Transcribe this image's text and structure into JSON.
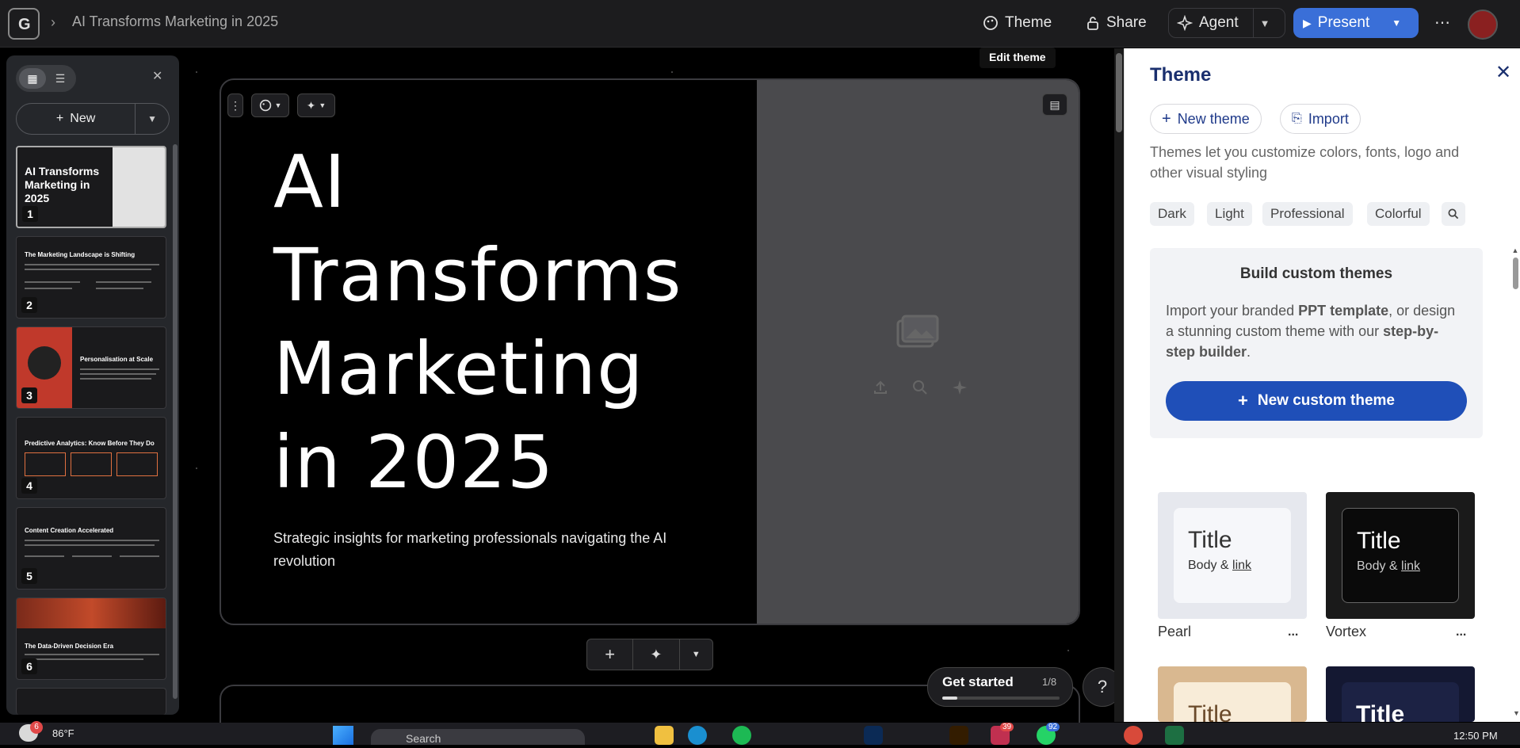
{
  "topbar": {
    "doc_title": "AI Transforms Marketing in 2025",
    "theme_label": "Theme",
    "share_label": "Share",
    "agent_label": "Agent",
    "present_label": "Present",
    "tooltip": "Edit theme"
  },
  "sidebar": {
    "new_label": "New",
    "slides": [
      {
        "num": "1",
        "title": "AI Transforms Marketing in 2025"
      },
      {
        "num": "2",
        "title": "The Marketing Landscape is Shifting"
      },
      {
        "num": "3",
        "title": "Personalisation at Scale"
      },
      {
        "num": "4",
        "title": "Predictive Analytics: Know Before They Do"
      },
      {
        "num": "5",
        "title": "Content Creation Accelerated"
      },
      {
        "num": "6",
        "title": "The Data-Driven Decision Era"
      }
    ]
  },
  "slide": {
    "title": "AI Transforms Marketing in 2025",
    "subtitle": "Strategic insights for marketing professionals navigating the AI revolution"
  },
  "get_started": {
    "label": "Get started",
    "progress": "1/8",
    "progress_fraction": 0.125
  },
  "help_label": "?",
  "panel": {
    "heading": "Theme",
    "new_theme_label": "New theme",
    "import_label": "Import",
    "description": "Themes let you customize colors, fonts, logo and other visual styling",
    "filters": [
      "Dark",
      "Light",
      "Professional",
      "Colorful"
    ],
    "custom": {
      "heading": "Build custom themes",
      "text_a": "Import your branded ",
      "text_b": "PPT template",
      "text_c": ", or design a stunning custom theme with our ",
      "text_d": "step-by-step builder",
      "text_e": ".",
      "button": "New custom theme"
    },
    "themes": [
      {
        "name": "Pearl",
        "title": "Title",
        "body": "Body & ",
        "link": "link",
        "more": "..."
      },
      {
        "name": "Vortex",
        "title": "Title",
        "body": "Body & ",
        "link": "link",
        "more": "..."
      },
      {
        "title": "Title"
      },
      {
        "title": "Title"
      }
    ]
  },
  "taskbar": {
    "weather_badge": "6",
    "temperature": "86°F",
    "search_placeholder": "Search",
    "badge_a": "39",
    "badge_b": "92",
    "time": "12:50 PM"
  },
  "colors": {
    "accent": "#3a6fd8",
    "custom_button": "#1f4fb8"
  }
}
